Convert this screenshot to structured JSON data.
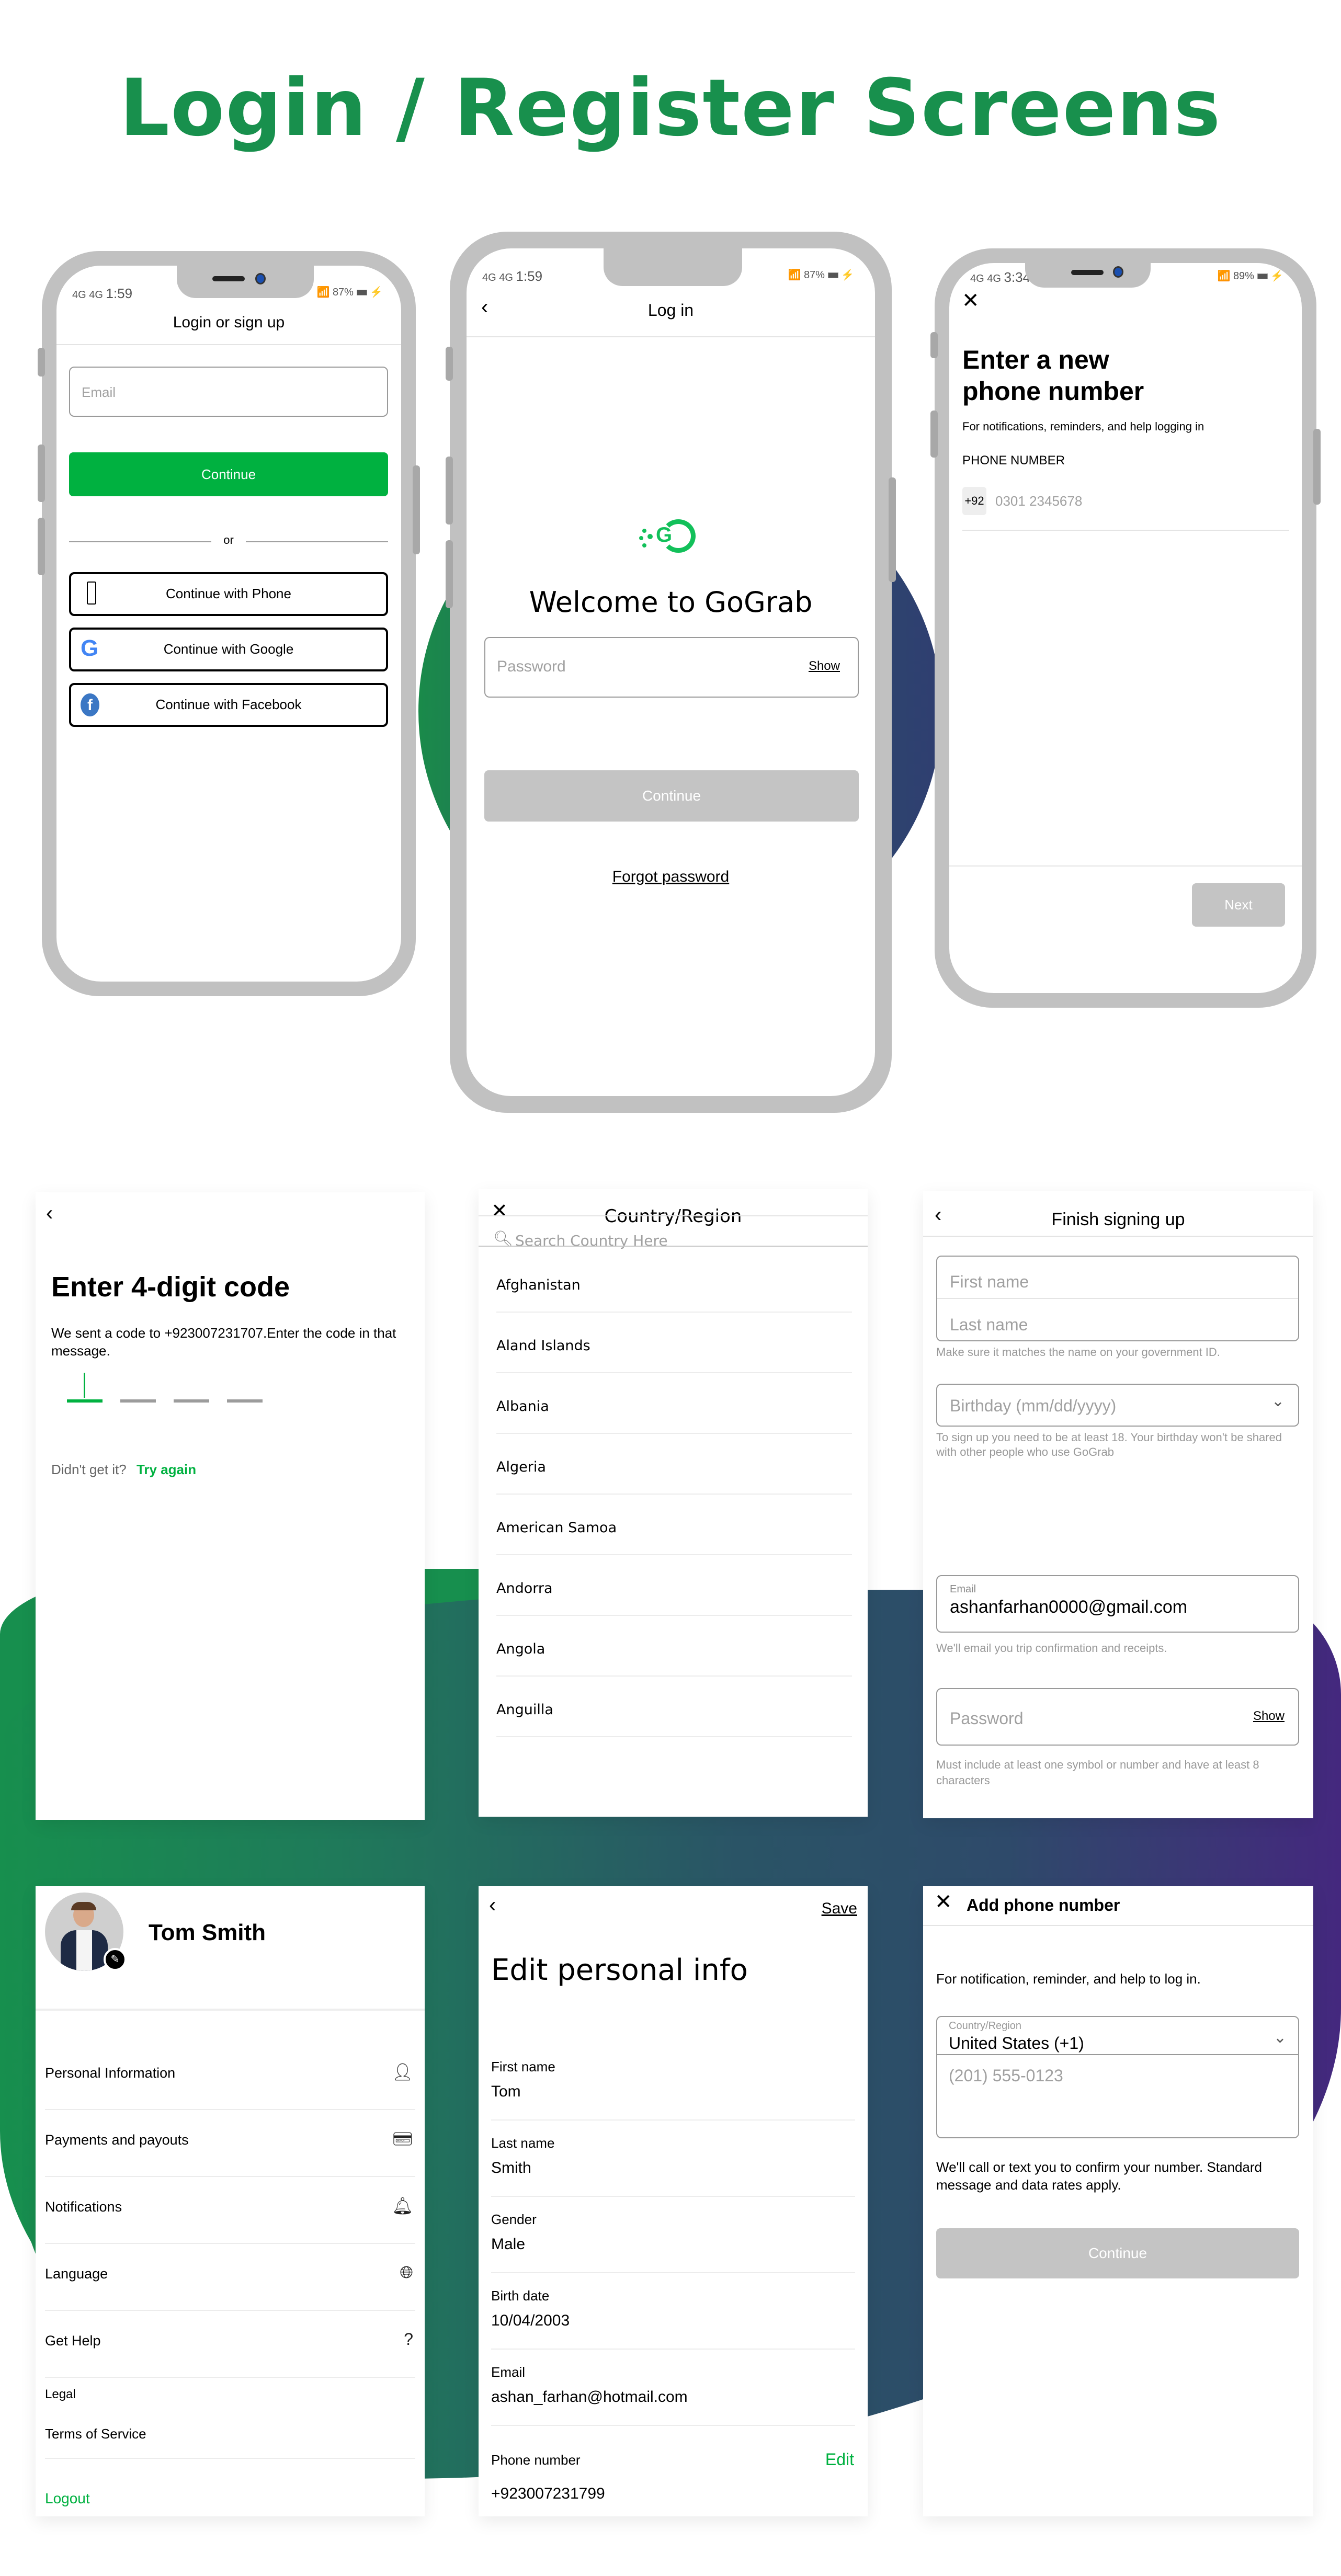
{
  "page_title": "Login / Register Screens",
  "colors": {
    "brand_green": "#18904d",
    "accent_green": "#00b140",
    "disabled_grey": "#c4c4c4"
  },
  "status_bars": {
    "phone1": {
      "network": "4G 4G",
      "time": "1:59",
      "battery": "87%"
    },
    "phone2": {
      "network": "4G 4G",
      "time": "1:59",
      "battery": "87%"
    },
    "phone3": {
      "network": "4G 4G",
      "time": "3:34",
      "battery": "89%"
    }
  },
  "login_signup": {
    "title": "Login or sign up",
    "email_placeholder": "Email",
    "continue_label": "Continue",
    "or_label": "or",
    "social_buttons": [
      {
        "label": "Continue with Phone",
        "icon": "phone-icon"
      },
      {
        "label": "Continue with Google",
        "icon": "google-icon"
      },
      {
        "label": "Continue with Facebook",
        "icon": "facebook-icon"
      }
    ]
  },
  "log_in": {
    "title": "Log in",
    "back_icon": "chevron-left-icon",
    "logo_icon": "gograb-logo",
    "welcome": "Welcome to GoGrab",
    "password_placeholder": "Password",
    "show_label": "Show",
    "continue_label": "Continue",
    "forgot_label": "Forgot password"
  },
  "new_phone": {
    "close_icon": "close-icon",
    "heading_line1": "Enter a new",
    "heading_line2": "phone number",
    "subtitle": "For notifications, reminders, and help logging in",
    "field_label": "PHONE NUMBER",
    "country_code": "+92",
    "phone_placeholder": "0301 2345678",
    "next_label": "Next"
  },
  "code_entry": {
    "heading": "Enter 4-digit code",
    "message": "We sent a code to +923007231707.Enter the code in that message.",
    "digits_count": 4,
    "active_digit": 1,
    "didnt_get": "Didn't get it?",
    "try_again": "Try again"
  },
  "country_region": {
    "title": "Country/Region",
    "search_placeholder": "Search Country Here",
    "countries": [
      "Afghanistan",
      "Aland Islands",
      "Albania",
      "Algeria",
      "American Samoa",
      "Andorra",
      "Angola",
      "Anguilla"
    ]
  },
  "finish_signup": {
    "title": "Finish signing up",
    "first_name_placeholder": "First name",
    "last_name_placeholder": "Last name",
    "name_hint": "Make sure it matches the name on your government ID.",
    "birthday_placeholder": "Birthday (mm/dd/yyyy)",
    "birthday_hint": "To sign up you need to be at least 18. Your birthday won't be shared with other people who use GoGrab",
    "email_label": "Email",
    "email_value": "ashanfarhan0000@gmail.com",
    "email_hint": "We'll email you trip confirmation and receipts.",
    "password_placeholder": "Password",
    "show_label": "Show",
    "password_hint": "Must include at least one symbol or number and have at least 8 characters"
  },
  "profile": {
    "name": "Tom Smith",
    "menu": [
      {
        "label": "Personal Information",
        "icon": "user-icon"
      },
      {
        "label": "Payments and payouts",
        "icon": "payment-icon"
      },
      {
        "label": "Notifications",
        "icon": "bell-icon"
      },
      {
        "label": "Language",
        "icon": "globe-icon"
      },
      {
        "label": "Get Help",
        "icon": "help-icon"
      }
    ],
    "legal_label": "Legal",
    "terms_label": "Terms of Service",
    "logout_label": "Logout"
  },
  "edit_info": {
    "save_label": "Save",
    "heading": "Edit personal info",
    "fields": [
      {
        "label": "First name",
        "value": "Tom"
      },
      {
        "label": "Last name",
        "value": "Smith"
      },
      {
        "label": "Gender",
        "value": "Male"
      },
      {
        "label": "Birth date",
        "value": "10/04/2003"
      },
      {
        "label": "Email",
        "value": "ashan_farhan@hotmail.com"
      }
    ],
    "phone_label": "Phone number",
    "phone_edit": "Edit",
    "phone_value": "+923007231799"
  },
  "add_phone": {
    "title": "Add phone number",
    "subtitle": "For notification, reminder, and help to log in.",
    "country_label": "Country/Region",
    "country_value": "United States (+1)",
    "phone_placeholder": "(201) 555-0123",
    "notice": "We'll call or text you to confirm your number. Standard message and data rates apply.",
    "continue_label": "Continue"
  }
}
